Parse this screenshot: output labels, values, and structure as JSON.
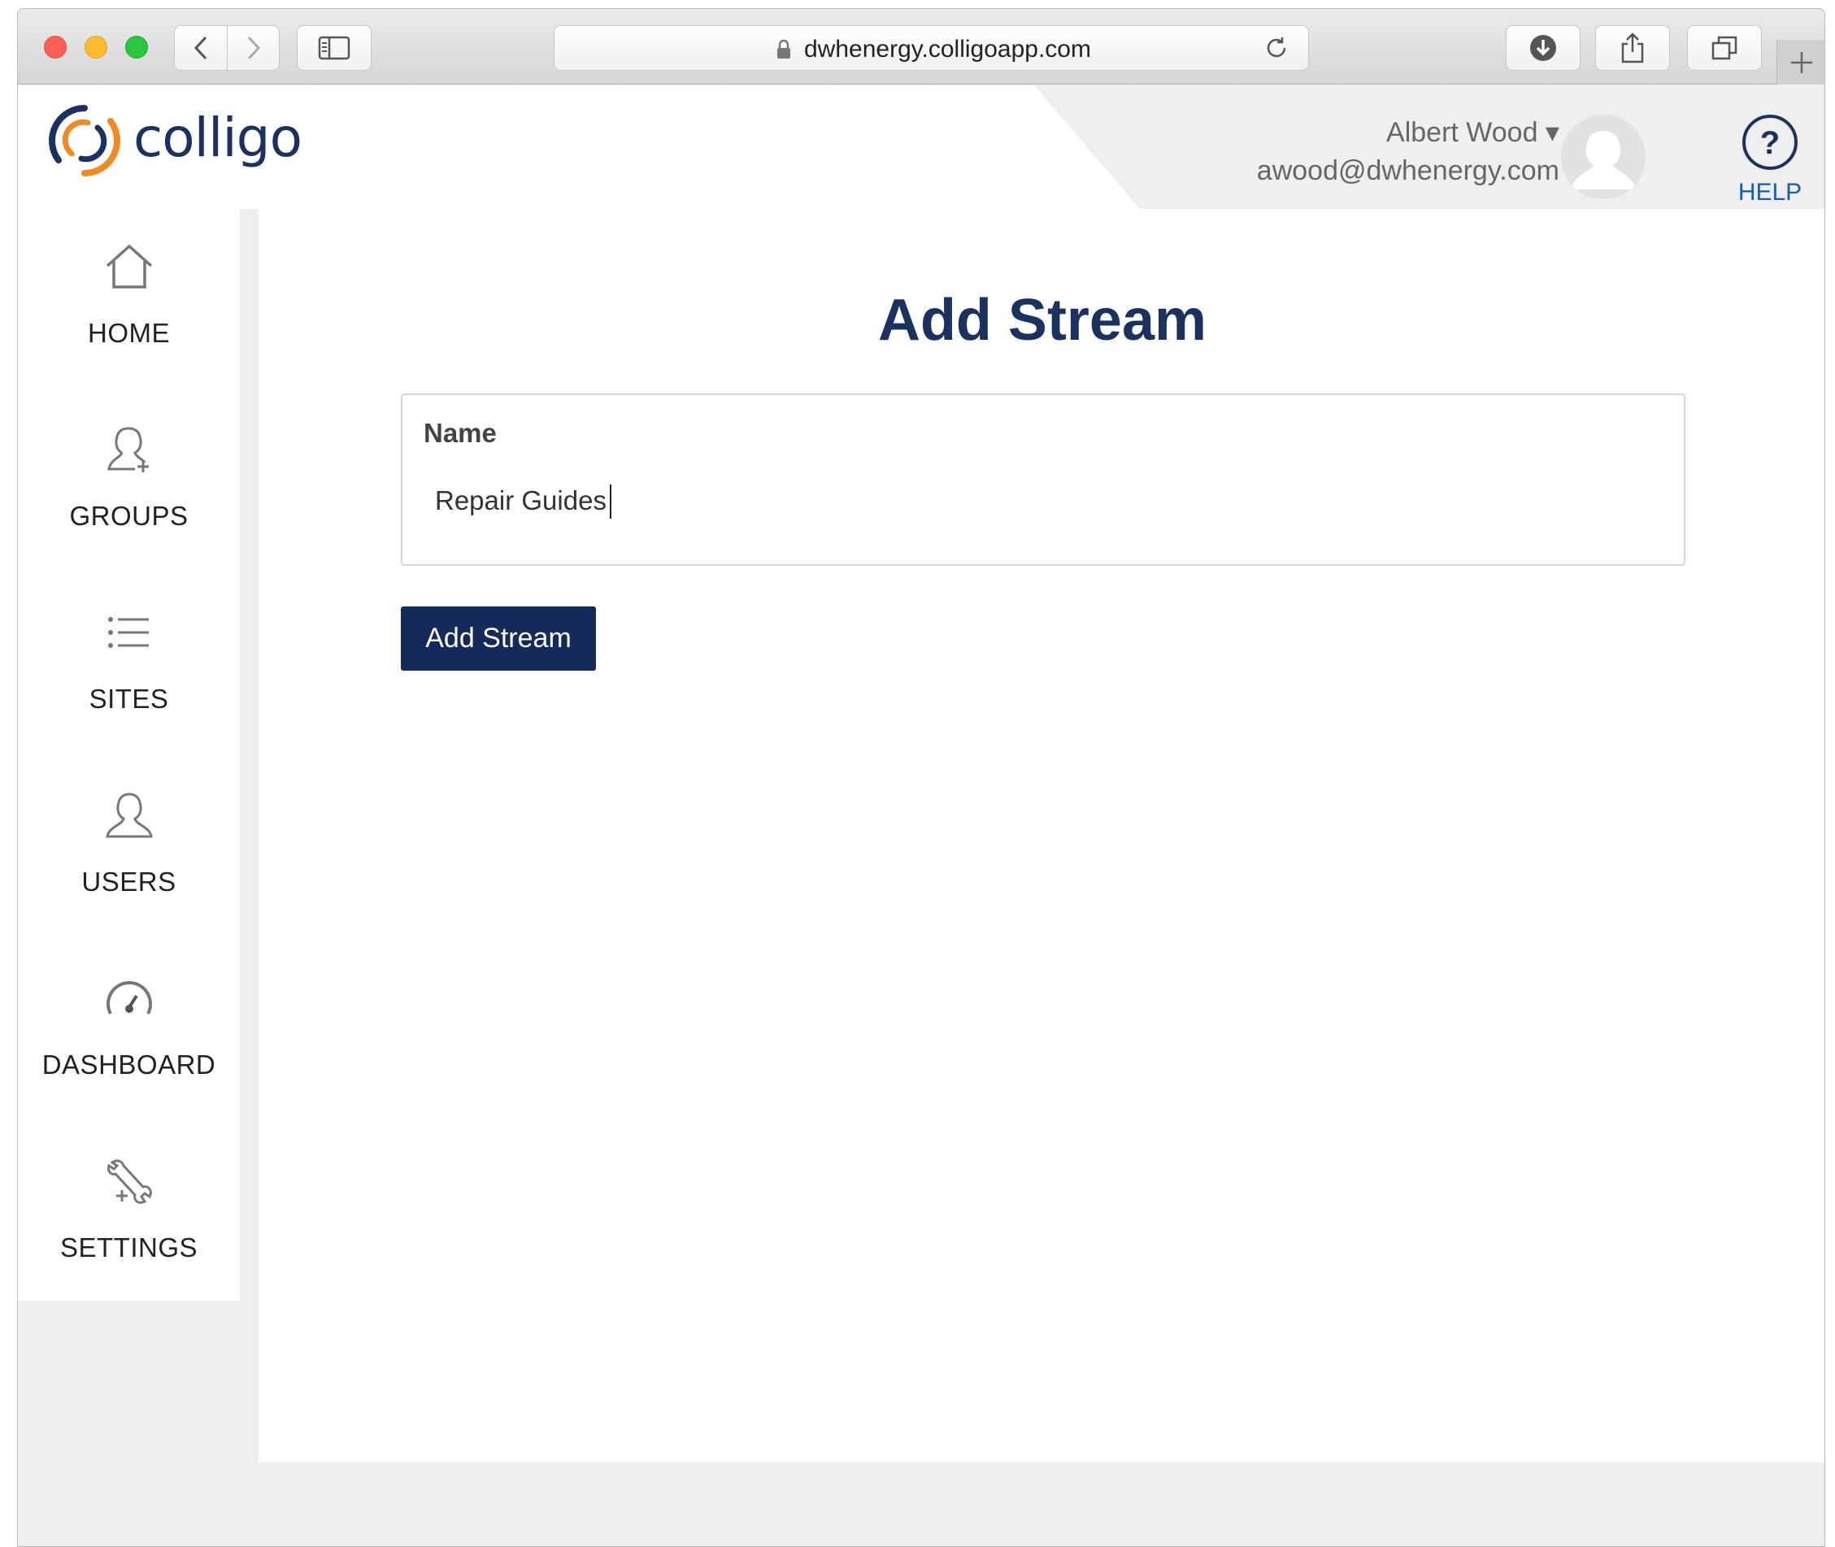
{
  "browser": {
    "url": "dwhenergy.colligoapp.com"
  },
  "header": {
    "logo_text": "colligo",
    "user_name": "Albert Wood ▾",
    "user_email": "awood@dwhenergy.com",
    "help_label": "HELP"
  },
  "nav": {
    "items": [
      {
        "label": "HOME",
        "icon": "home-icon"
      },
      {
        "label": "GROUPS",
        "icon": "add-user-icon"
      },
      {
        "label": "SITES",
        "icon": "list-icon"
      },
      {
        "label": "USERS",
        "icon": "user-icon"
      },
      {
        "label": "DASHBOARD",
        "icon": "gauge-icon"
      },
      {
        "label": "SETTINGS",
        "icon": "wrench-icon"
      }
    ]
  },
  "main": {
    "title": "Add Stream",
    "name_label": "Name",
    "name_value": "Repair Guides",
    "submit_label": "Add Stream"
  },
  "colors": {
    "brand_navy": "#1b3160",
    "button_navy": "#132a5a",
    "logo_orange": "#f08a24",
    "help_blue": "#1a5ea8"
  }
}
